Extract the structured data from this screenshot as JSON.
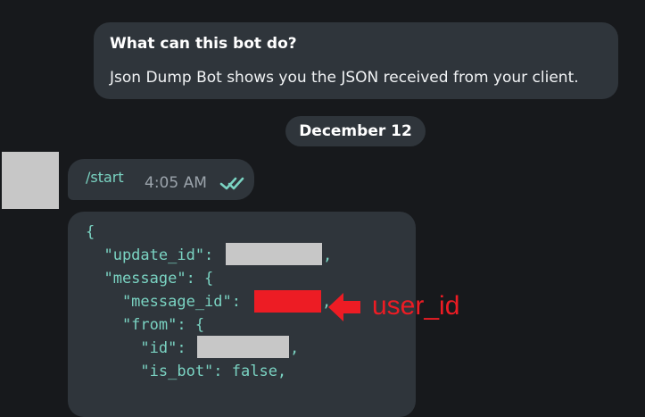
{
  "intro": {
    "title": "What can this bot do?",
    "text": "Json Dump Bot shows you the JSON received from your client."
  },
  "date_divider": "December 12",
  "start_message": {
    "text": "/start",
    "time": "4:05 AM",
    "status_icon": "double-check-icon"
  },
  "code_block": {
    "lines": [
      "{",
      "  \"update_id\":",
      "  \"message\": {",
      "    \"message_id\":",
      "    \"from\": {",
      "      \"id\":",
      "      \"is_bot\": false,"
    ],
    "comma": ","
  },
  "annotation": {
    "label": "user_id",
    "color": "#ed1c24",
    "icon": "arrow-left-icon"
  },
  "colors": {
    "background": "#17191c",
    "bubble": "#2f353b",
    "code": "#7ad3c2",
    "redaction": "#c7c7c7"
  }
}
